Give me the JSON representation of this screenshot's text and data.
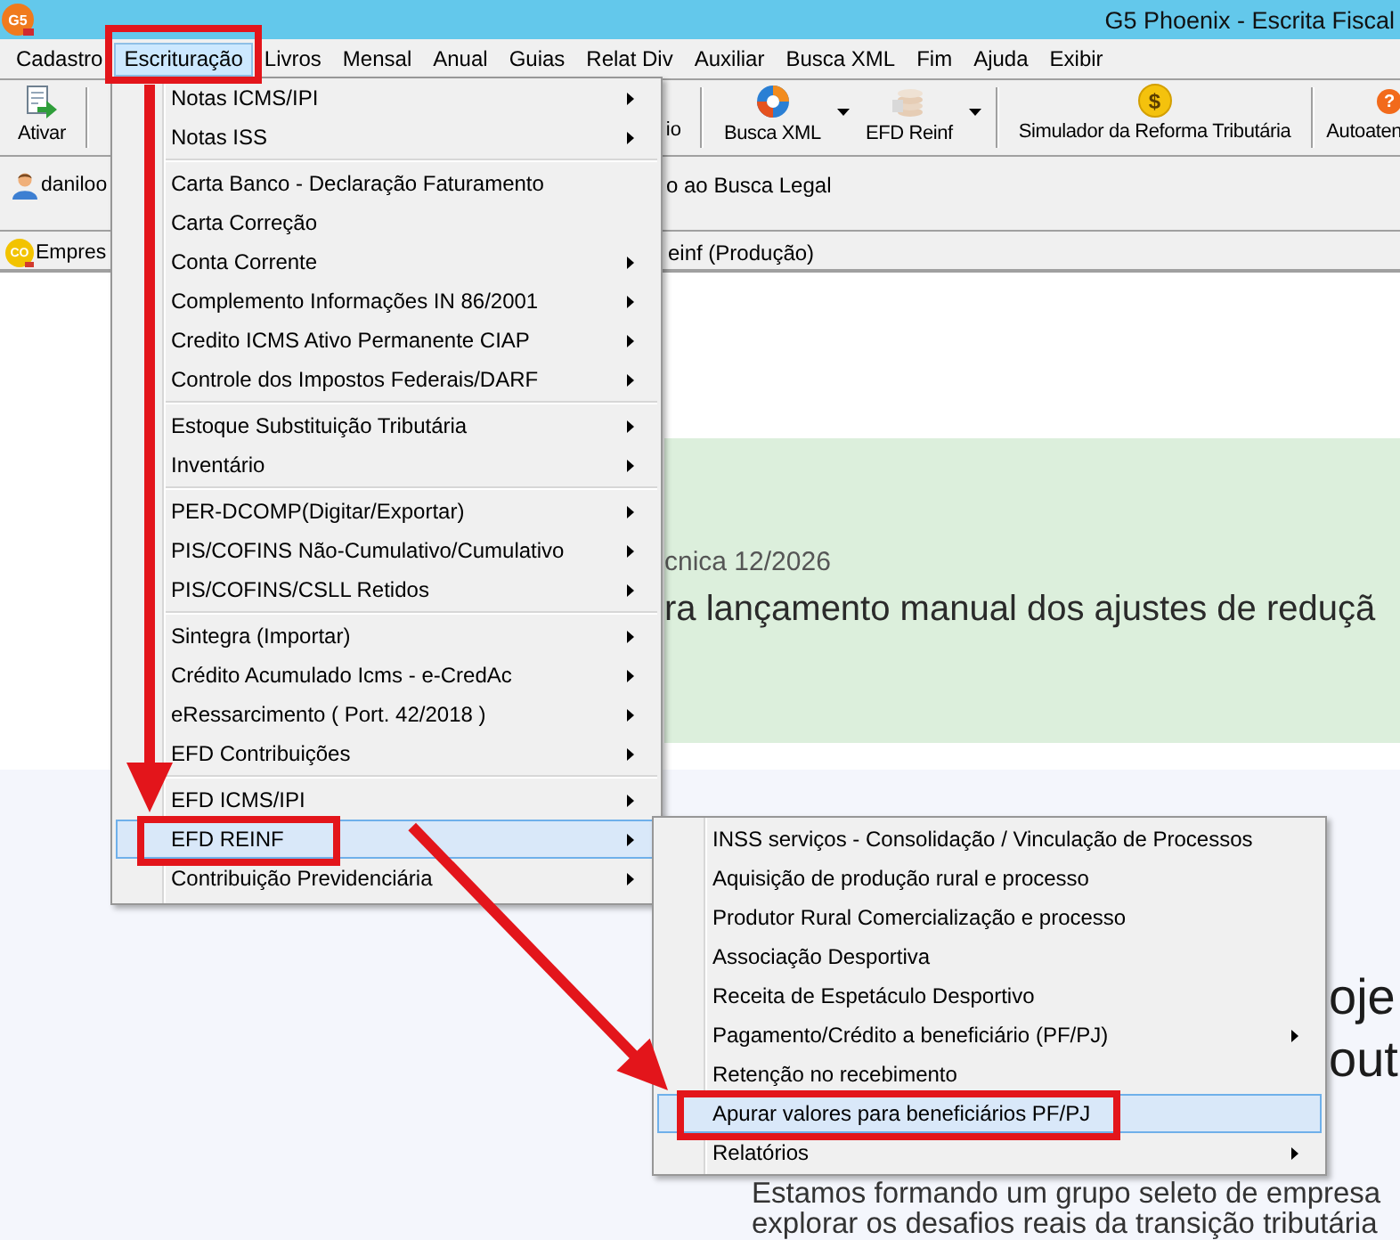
{
  "window": {
    "title": "G5 Phoenix - Escrita Fiscal",
    "logo_text": "G5"
  },
  "menubar": [
    {
      "label": "Cadastro",
      "selected": false,
      "highlighted": false
    },
    {
      "label": "Escrituração",
      "selected": true,
      "highlighted": true
    },
    {
      "label": "Livros",
      "selected": false,
      "highlighted": false
    },
    {
      "label": "Mensal",
      "selected": false,
      "highlighted": false
    },
    {
      "label": "Anual",
      "selected": false,
      "highlighted": false
    },
    {
      "label": "Guias",
      "selected": false,
      "highlighted": false
    },
    {
      "label": "Relat Div",
      "selected": false,
      "highlighted": false
    },
    {
      "label": "Auxiliar",
      "selected": false,
      "highlighted": false
    },
    {
      "label": "Busca XML",
      "selected": false,
      "highlighted": false
    },
    {
      "label": "Fim",
      "selected": false,
      "highlighted": false
    },
    {
      "label": "Ajuda",
      "selected": false,
      "highlighted": false
    },
    {
      "label": "Exibir",
      "selected": false,
      "highlighted": false
    }
  ],
  "toolbar": {
    "groups": [
      [
        {
          "kind": "button",
          "label": "Ativar"
        }
      ],
      [
        {
          "kind": "fragment",
          "label": "io"
        }
      ],
      [
        {
          "kind": "split",
          "label": "Busca XML"
        },
        {
          "kind": "split",
          "label": "EFD Reinf"
        }
      ],
      [
        {
          "kind": "button",
          "label": "Simulador da Reforma Tributária",
          "icon_text": "$"
        }
      ],
      [
        {
          "kind": "button",
          "label": "Autoaten",
          "icon_text": "?"
        }
      ]
    ]
  },
  "user_bar": {
    "user": "daniloo",
    "fragment": "o ao Busca Legal"
  },
  "company_bar": {
    "badge": "CO",
    "company": "Empres",
    "fragment": "einf (Produção)"
  },
  "menu": {
    "groups": [
      [
        {
          "label": "Notas ICMS/IPI",
          "has_submenu": true,
          "selected": false,
          "highlighted": false
        },
        {
          "label": "Notas ISS",
          "has_submenu": true,
          "selected": false,
          "highlighted": false
        }
      ],
      [
        {
          "label": "Carta Banco - Declaração Faturamento",
          "has_submenu": false,
          "selected": false,
          "highlighted": false
        },
        {
          "label": "Carta Correção",
          "has_submenu": false,
          "selected": false,
          "highlighted": false
        },
        {
          "label": "Conta Corrente",
          "has_submenu": true,
          "selected": false,
          "highlighted": false
        },
        {
          "label": "Complemento Informações IN 86/2001",
          "has_submenu": true,
          "selected": false,
          "highlighted": false
        },
        {
          "label": "Credito ICMS Ativo Permanente CIAP",
          "has_submenu": true,
          "selected": false,
          "highlighted": false
        },
        {
          "label": "Controle dos Impostos Federais/DARF",
          "has_submenu": true,
          "selected": false,
          "highlighted": false
        }
      ],
      [
        {
          "label": "Estoque Substituição Tributária",
          "has_submenu": true,
          "selected": false,
          "highlighted": false
        },
        {
          "label": "Inventário",
          "has_submenu": true,
          "selected": false,
          "highlighted": false
        }
      ],
      [
        {
          "label": "PER-DCOMP(Digitar/Exportar)",
          "has_submenu": true,
          "selected": false,
          "highlighted": false
        },
        {
          "label": "PIS/COFINS Não-Cumulativo/Cumulativo",
          "has_submenu": true,
          "selected": false,
          "highlighted": false
        },
        {
          "label": "PIS/COFINS/CSLL Retidos",
          "has_submenu": true,
          "selected": false,
          "highlighted": false
        }
      ],
      [
        {
          "label": "Sintegra (Importar)",
          "has_submenu": true,
          "selected": false,
          "highlighted": false
        },
        {
          "label": "Crédito Acumulado Icms - e-CredAc",
          "has_submenu": true,
          "selected": false,
          "highlighted": false
        },
        {
          "label": "eRessarcimento ( Port. 42/2018 )",
          "has_submenu": true,
          "selected": false,
          "highlighted": false
        },
        {
          "label": "EFD Contribuições",
          "has_submenu": true,
          "selected": false,
          "highlighted": false
        }
      ],
      [
        {
          "label": "EFD ICMS/IPI",
          "has_submenu": true,
          "selected": false,
          "highlighted": false
        },
        {
          "label": "EFD REINF",
          "has_submenu": true,
          "selected": true,
          "highlighted": true,
          "submenu": [
            {
              "label": "INSS serviços - Consolidação / Vinculação de Processos",
              "has_submenu": false,
              "selected": false,
              "highlighted": false
            },
            {
              "label": "Aquisição de produção rural e processo",
              "has_submenu": false,
              "selected": false,
              "highlighted": false
            },
            {
              "label": "Produtor Rural Comercialização e processo",
              "has_submenu": false,
              "selected": false,
              "highlighted": false
            },
            {
              "label": "Associação Desportiva",
              "has_submenu": false,
              "selected": false,
              "highlighted": false
            },
            {
              "label": "Receita de Espetáculo Desportivo",
              "has_submenu": false,
              "selected": false,
              "highlighted": false
            },
            {
              "label": "Pagamento/Crédito a beneficiário (PF/PJ)",
              "has_submenu": true,
              "selected": false,
              "highlighted": false
            },
            {
              "label": "Retenção no recebimento",
              "has_submenu": false,
              "selected": false,
              "highlighted": false
            },
            {
              "label": "Apurar valores para beneficiários PF/PJ",
              "has_submenu": false,
              "selected": true,
              "highlighted": true
            },
            {
              "label": "Relatórios",
              "has_submenu": true,
              "selected": false,
              "highlighted": false
            }
          ]
        },
        {
          "label": "Contribuição Previdenciária",
          "has_submenu": true,
          "selected": false,
          "highlighted": false
        }
      ]
    ]
  },
  "notice": {
    "meta": "cnica 12/2026",
    "headline": "ra lançamento manual dos ajustes de reduçã"
  },
  "promo": {
    "heading_lines": [
      "oje",
      "out"
    ],
    "paragraph_lines": [
      "Estamos formando um grupo seleto de empresa",
      "explorar os desafios reais da transição tributária"
    ]
  },
  "annotation_arrows": true
}
